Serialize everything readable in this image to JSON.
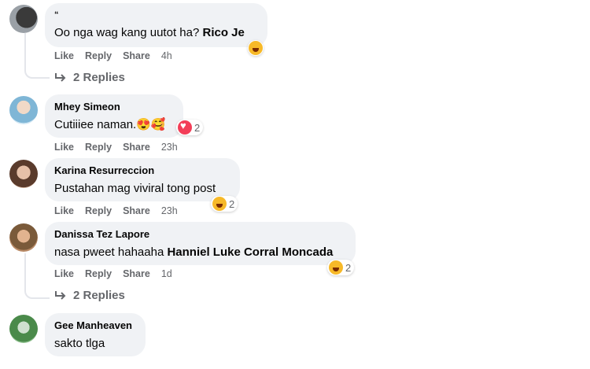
{
  "comments": [
    {
      "name": "“",
      "text": "Oo nga wag kang uutot ha? ",
      "tag": "Rico Je",
      "actions": {
        "like": "Like",
        "reply": "Reply",
        "share": "Share",
        "time": "4h"
      },
      "replies": "2 Replies",
      "reaction": {
        "icon": "laugh-emoji",
        "count": ""
      }
    },
    {
      "name": "Mhey Simeon",
      "text": "Cutiiiee naman.",
      "inline_emojis": "😍🥰",
      "actions": {
        "like": "Like",
        "reply": "Reply",
        "share": "Share",
        "time": "23h"
      },
      "reaction": {
        "icon": "heart-reaction",
        "count": "2"
      }
    },
    {
      "name": "Karina Resurreccion",
      "text": "Pustahan mag viviral tong post",
      "actions": {
        "like": "Like",
        "reply": "Reply",
        "share": "Share",
        "time": "23h"
      },
      "reaction": {
        "icon": "laugh-emoji",
        "count": "2"
      }
    },
    {
      "name": "Danissa Tez Lapore",
      "text": "nasa pweet hahaaha ",
      "tag": "Hanniel Luke Corral Moncada",
      "actions": {
        "like": "Like",
        "reply": "Reply",
        "share": "Share",
        "time": "1d"
      },
      "replies": "2 Replies",
      "reaction": {
        "icon": "laugh-emoji",
        "count": "2"
      }
    },
    {
      "name": "Gee Manheaven",
      "text": "sakto tlga"
    }
  ],
  "colors": {
    "bubble": "#f0f2f5",
    "meta": "#65676b",
    "text": "#050505"
  }
}
